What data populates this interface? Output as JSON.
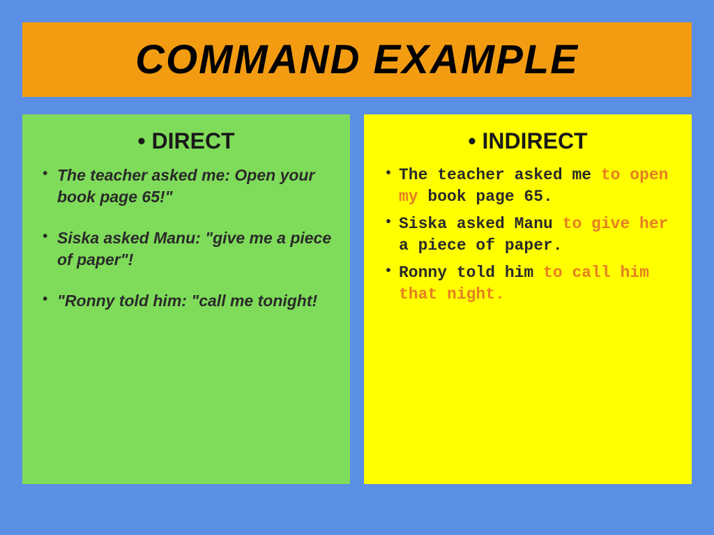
{
  "title": "COMMAND EXAMPLE",
  "left": {
    "heading": "DIRECT",
    "items": [
      "The teacher asked me: Open your book page 65!\"",
      "Siska asked Manu: \"give me a piece of paper\"!",
      "\"Ronny told him: \"call me tonight!"
    ]
  },
  "right": {
    "heading": "INDIRECT",
    "items": [
      {
        "pre": "The teacher asked me ",
        "hl": "to open my",
        "post": " book page 65."
      },
      {
        "pre": "Siska asked Manu ",
        "hl": "to give her",
        "post": " a piece of paper."
      },
      {
        "pre": "Ronny told him ",
        "hl": "to call him that night.",
        "post": ""
      }
    ]
  }
}
